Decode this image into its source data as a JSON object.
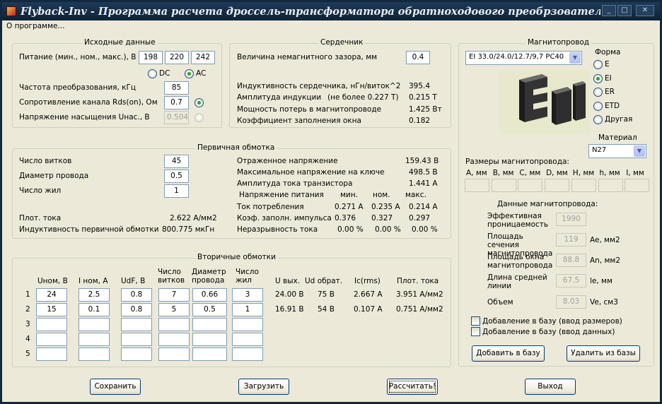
{
  "window": {
    "title": "Flyback-Inv - Программа расчета дроссель-трансформатора обратноходового преобрзователя - обр...",
    "min": "_",
    "max": "□",
    "close": "✕"
  },
  "menu": {
    "about": "О программе..."
  },
  "input": {
    "title": "Исходные данные",
    "supply_label": "Питание (мин., ном., макс.), В",
    "vmin": "198",
    "vnom": "220",
    "vmax": "242",
    "dc": "DC",
    "ac": "AC",
    "freq_label": "Частота преобразования, кГц",
    "freq": "85",
    "rds_label": "Сопротивление канала Rds(on), Ом",
    "rds": "0.7",
    "usat_label": "Напряжение насыщения Uнас., В",
    "usat": "0.504"
  },
  "core": {
    "title": "Сердечник",
    "gap_label": "Величина немагнитного зазора, мм",
    "gap": "0.4",
    "al_label": "Индуктивность сердечника, нГн/виток^2",
    "al": "395.4",
    "b_label": "Амплитуда индукции",
    "b_note": "(не более 0.227 Т)",
    "b": "0.215 Т",
    "p_label": "Мощность потерь в магнитопроводе",
    "p": "1.425 Вт",
    "fill_label": "Коэффициент заполнения окна",
    "fill": "0.182"
  },
  "primary": {
    "title": "Первичная обмотка",
    "turns_label": "Число витков",
    "turns": "45",
    "wire_label": "Диаметр провода",
    "wire": "0.5",
    "strands_label": "Число жил",
    "strands": "1",
    "j_label": "Плот. тока",
    "j": "2.622 А/мм2",
    "l_label": "Индуктивность первичной обмотки",
    "l": "800.775 мкГн",
    "vr_label": "Отраженное напряжение",
    "vr": "159.43 В",
    "vmaxsw_label": "Максимальное напряжение на ключе",
    "vmaxsw": "498.5 В",
    "ipk_label": "Амплитуда тока транзистора",
    "ipk": "1.441 А",
    "vs_label": "Напряжение питания",
    "col_min": "мин.",
    "col_nom": "ном.",
    "col_max": "макс.",
    "icons_label": "Ток потребления",
    "icons": [
      "0.271 А",
      "0.235 А",
      "0.214 А"
    ],
    "duty_label": "Коэф. заполн. импульса",
    "duty": [
      "0.376",
      "0.327",
      "0.297"
    ],
    "cont_label": "Неразрывность тока",
    "cont": [
      "0.00 %",
      "0.00 %",
      "0.00 %"
    ]
  },
  "secondary": {
    "title": "Вторичные обмотки",
    "headers": [
      "Uном, В",
      "I ном, А",
      "UdF, В",
      "Число витков",
      "Диаметр провода",
      "Число жил",
      "U вых.",
      "Ud обрат.",
      "Ic(rms)",
      "Плот. тока"
    ],
    "rows": [
      {
        "n": "1",
        "u": "24",
        "i": "2.5",
        "udf": "0.8",
        "turns": "7",
        "wire": "0.66",
        "str": "3",
        "uout": "24.00 В",
        "udrev": "75 В",
        "irms": "2.667 А",
        "j": "3.951 А/мм2"
      },
      {
        "n": "2",
        "u": "15",
        "i": "0.1",
        "udf": "0.8",
        "turns": "5",
        "wire": "0.5",
        "str": "1",
        "uout": "16.91 В",
        "udrev": "54 В",
        "irms": "0.107 А",
        "j": "0.751 А/мм2"
      },
      {
        "n": "3",
        "u": "",
        "i": "",
        "udf": "",
        "turns": "",
        "wire": "",
        "str": "",
        "uout": "",
        "udrev": "",
        "irms": "",
        "j": ""
      },
      {
        "n": "4",
        "u": "",
        "i": "",
        "udf": "",
        "turns": "",
        "wire": "",
        "str": "",
        "uout": "",
        "udrev": "",
        "irms": "",
        "j": ""
      },
      {
        "n": "5",
        "u": "",
        "i": "",
        "udf": "",
        "turns": "",
        "wire": "",
        "str": "",
        "uout": "",
        "udrev": "",
        "irms": "",
        "j": ""
      }
    ]
  },
  "magnetic": {
    "title": "Магнитопровод",
    "core_select": "EI 33.0/24.0/12.7/9,7 PC40",
    "shape_label": "Форма",
    "shapes": [
      "E",
      "EI",
      "ER",
      "ETD",
      "Другая"
    ],
    "material_label": "Материал",
    "material": "N27",
    "dims_label": "Размеры магнитопровода:",
    "dims": [
      "A, мм",
      "B, мм",
      "C, мм",
      "D, мм",
      "H, мм",
      "h, мм",
      "I, мм"
    ],
    "data_label": "Данные магнитопровода:",
    "mu_label": "Эффективная проницаемость",
    "mu": "1990",
    "ae_label": "Площадь сечения магнитопровода",
    "ae": "119",
    "ae_unit": "Ae, мм2",
    "an_label": "Площадь окна магнитопровода",
    "an": "88.8",
    "an_unit": "An, мм2",
    "le_label": "Длина средней линии",
    "le": "67.5",
    "le_unit": "le, мм",
    "ve_label": "Объем",
    "ve": "8.03",
    "ve_unit": "Ve, см3",
    "chk1": "Добавление в базу (ввод размеров)",
    "chk2": "Добавление в базу (ввод данных)",
    "add": "Добавить в базу",
    "del": "Удалить из базы"
  },
  "buttons": {
    "save": "Сохранить",
    "load": "Загрузить",
    "calc": "Рассчитать!",
    "exit": "Выход"
  }
}
